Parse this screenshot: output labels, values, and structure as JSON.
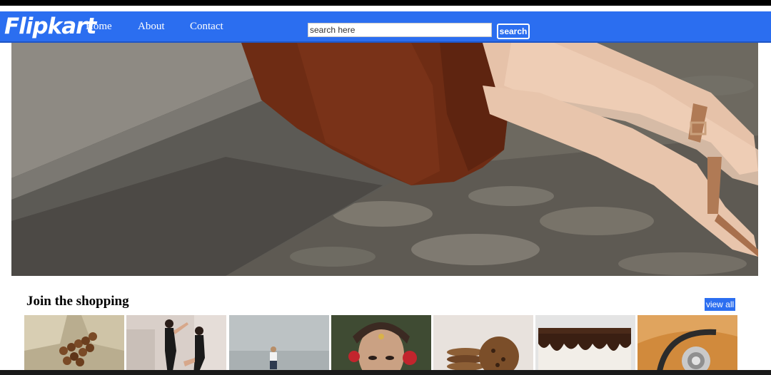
{
  "brand": {
    "logo": "Flipkart"
  },
  "nav": {
    "links": [
      {
        "label": "Home"
      },
      {
        "label": "About"
      },
      {
        "label": "Contact"
      }
    ]
  },
  "search": {
    "placeholder": "search here",
    "button_label": "search"
  },
  "section": {
    "title": "Join the shopping",
    "view_all_label": "view all"
  },
  "colors": {
    "brand_blue": "#2b6ef0",
    "page_bg": "#ffffff"
  },
  "tiles": [
    {
      "name": "nuts-necklace-tile"
    },
    {
      "name": "dancers-tile"
    },
    {
      "name": "person-by-sea-tile"
    },
    {
      "name": "jewelry-portrait-tile"
    },
    {
      "name": "cookies-tile"
    },
    {
      "name": "chocolate-cake-tile"
    },
    {
      "name": "stethoscope-tile"
    }
  ]
}
